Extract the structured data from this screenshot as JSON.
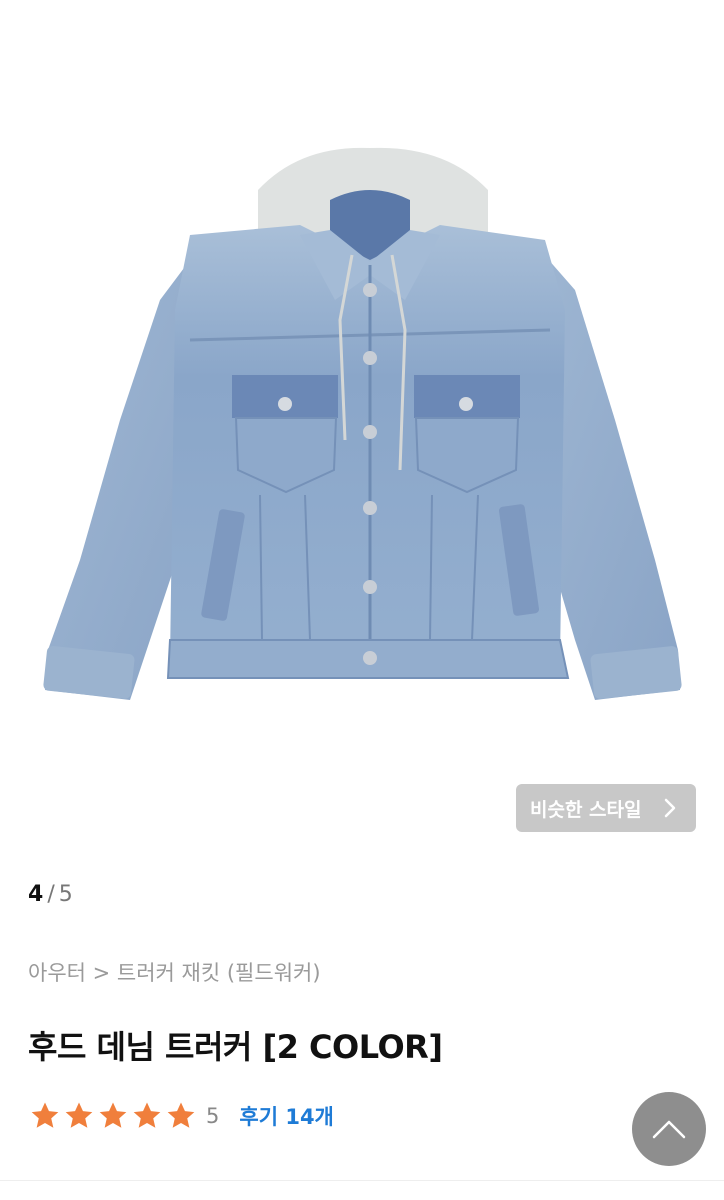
{
  "gallery": {
    "current": "4",
    "separator": "/",
    "total": "5",
    "similar_style_label": "비슷한 스타일"
  },
  "breadcrumb": "아우터 > 트러커 재킷 (필드워커)",
  "product": {
    "title": "후드 데님 트러커 [2 COLOR]",
    "stars_filled": 5,
    "rating": "5",
    "reviews_label": "후기 14개"
  },
  "colors": {
    "star": "#f07f3c",
    "review_link": "#1e7bd6",
    "similar_button_bg": "#c8c8c8",
    "scroll_top_bg": "#8e8e8e"
  },
  "icons": {
    "similar_button": "chevron-right-icon",
    "scroll_top": "chevron-up-icon",
    "rating": "star-icon"
  }
}
